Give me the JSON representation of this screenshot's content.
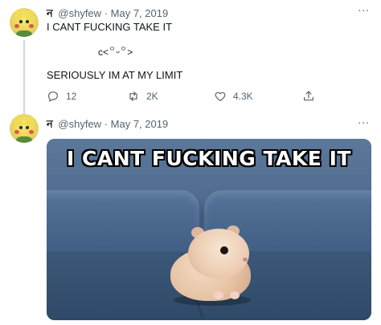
{
  "tweets": [
    {
      "author": {
        "display_name": "ন",
        "handle": "@shyfew",
        "separator": "·",
        "date": "May 7, 2019"
      },
      "more_label": "...",
      "lines": [
        "I CANT FUCKING TAKE IT",
        "c<꒪ᵕ꒪>",
        "SERIOUSLY IM AT MY LIMIT"
      ],
      "actions": {
        "reply_count": "12",
        "retweet_count": "2K",
        "like_count": "4.3K"
      }
    },
    {
      "author": {
        "display_name": "ন",
        "handle": "@shyfew",
        "separator": "·",
        "date": "May 7, 2019"
      },
      "more_label": "...",
      "media": {
        "caption": "I CANT FUCKING TAKE IT"
      }
    }
  ],
  "icons": {
    "avatar": "pikachu-avatar",
    "reply": "reply-icon",
    "retweet": "retweet-icon",
    "like": "heart-icon",
    "share": "share-icon",
    "more": "more-icon"
  },
  "colors": {
    "text_primary": "#0f1419",
    "text_secondary": "#536471",
    "thread_line": "#cfd9de"
  }
}
